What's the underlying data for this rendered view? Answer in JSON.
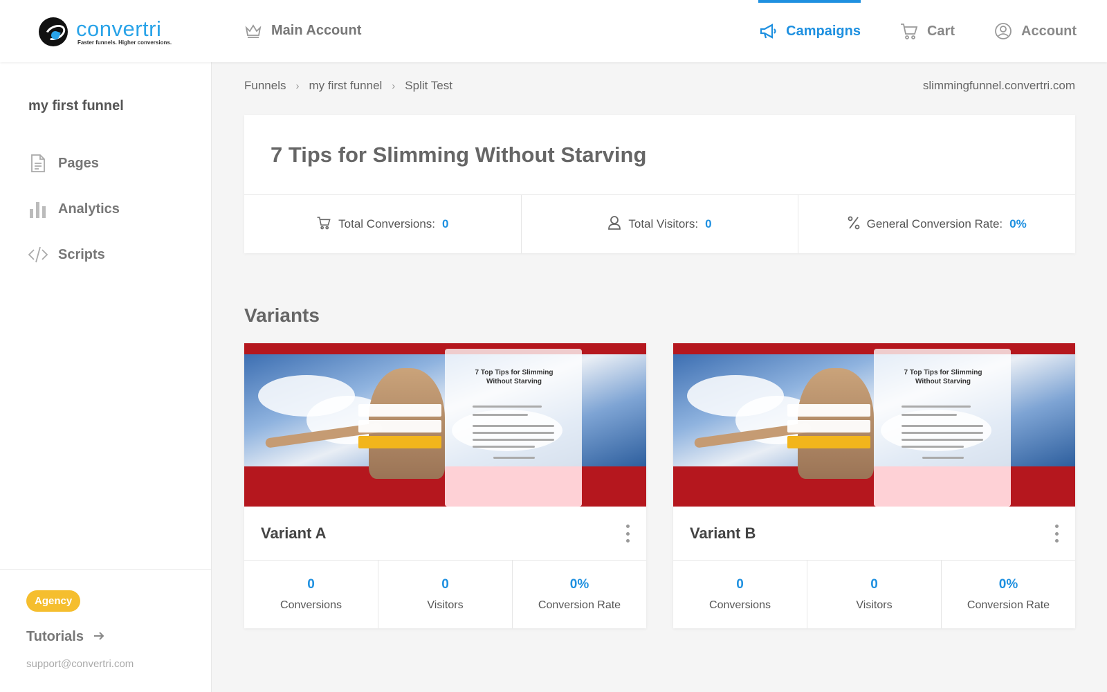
{
  "brand": {
    "name": "convertri",
    "tagline": "Faster funnels. Higher conversions."
  },
  "nav": {
    "main_account": "Main Account",
    "campaigns": "Campaigns",
    "cart": "Cart",
    "account": "Account"
  },
  "sidebar": {
    "funnel_name": "my first funnel",
    "items": [
      {
        "label": "Pages",
        "icon": "document-icon"
      },
      {
        "label": "Analytics",
        "icon": "bar-chart-icon"
      },
      {
        "label": "Scripts",
        "icon": "code-icon"
      }
    ],
    "badge": "Agency",
    "tutorials": "Tutorials",
    "support_email": "support@convertri.com"
  },
  "breadcrumb": [
    "Funnels",
    "my first funnel",
    "Split Test"
  ],
  "domain": "slimmingfunnel.convertri.com",
  "summary": {
    "title": "7 Tips for Slimming Without Starving",
    "total_conversions_label": "Total Conversions:",
    "total_conversions_value": "0",
    "total_visitors_label": "Total Visitors:",
    "total_visitors_value": "0",
    "conversion_rate_label": "General Conversion Rate:",
    "conversion_rate_value": "0%"
  },
  "variants_title": "Variants",
  "thumbnail_heading": "7 Top Tips for Slimming Without Starving",
  "variants": [
    {
      "name": "Variant A",
      "conversions": "0",
      "visitors": "0",
      "rate": "0%"
    },
    {
      "name": "Variant B",
      "conversions": "0",
      "visitors": "0",
      "rate": "0%"
    }
  ],
  "labels": {
    "conversions": "Conversions",
    "visitors": "Visitors",
    "conversion_rate": "Conversion Rate"
  },
  "colors": {
    "accent": "#1e90e0",
    "badge": "#f5be2e",
    "thumb_red": "#b5171e"
  }
}
